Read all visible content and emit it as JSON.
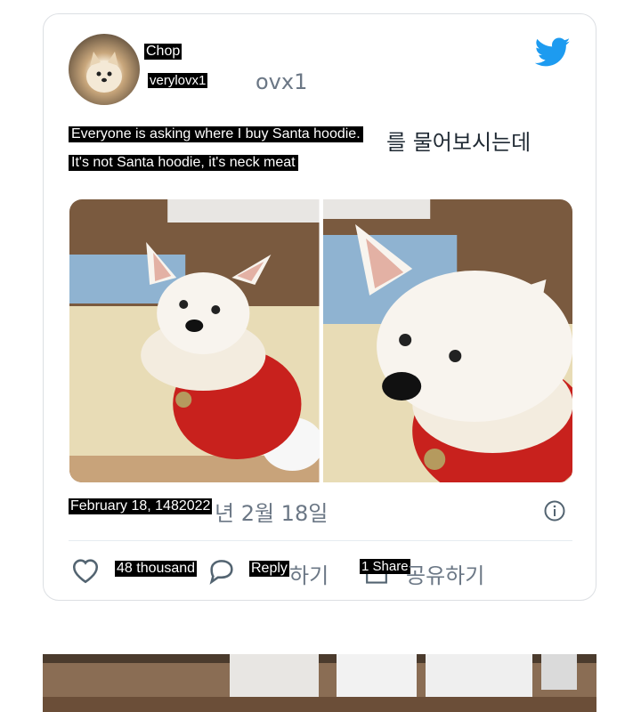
{
  "tweet": {
    "display_name": "Chop",
    "handle_overlay": "verylovx1",
    "handle_tail": "ovx1",
    "text_line1": "Everyone is asking where I buy Santa hoodie.",
    "text_line1_tail": "를 물어보시는데",
    "text_line2": "It's not Santa hoodie, it's neck meat",
    "date_overlay": "February 18, 1482022",
    "date_tail": "년 2월 18일"
  },
  "actions": {
    "likes": "48 thousand",
    "reply": "Reply",
    "reply_tail": "하기",
    "share": "1 Share",
    "share_tail": "공유하기"
  },
  "colors": {
    "twitter_blue": "#1d9bf0",
    "icon_gray": "#536471",
    "border": "#dcdfe3"
  },
  "icons": [
    "twitter-bird-icon",
    "info-icon",
    "heart-icon",
    "reply-bubble-icon",
    "share-icon"
  ]
}
